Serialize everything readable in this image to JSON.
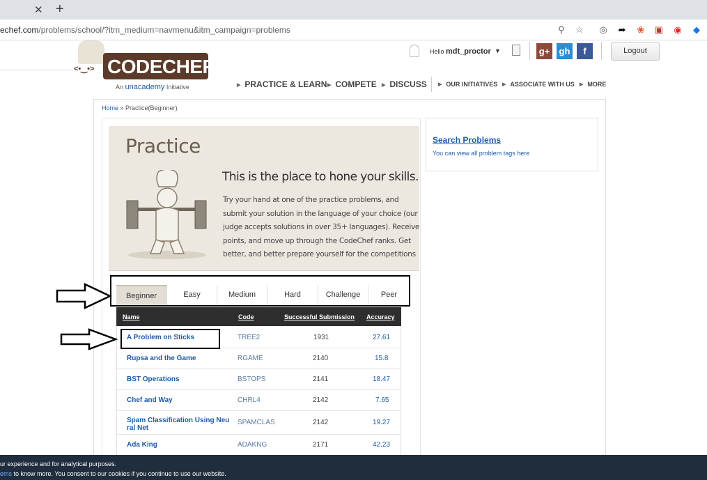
{
  "browser": {
    "url_host": "echef.com",
    "url_path": "/problems/school/?itm_medium=navmenu&itm_campaign=problems",
    "new_tab": "+",
    "close_tab": "✕"
  },
  "header": {
    "logo_text": "CODECHEF",
    "logo_face": "<•‿•>",
    "tagline_prefix": "An",
    "tagline_brand": "unacademy",
    "tagline_suffix": "Initiative",
    "greeting": "Hello",
    "username": "mdt_proctor",
    "logout": "Logout",
    "social": [
      "g+",
      "gh",
      "f"
    ],
    "nav_main": [
      "PRACTICE & LEARN",
      "COMPETE",
      "DISCUSS"
    ],
    "nav_small": [
      "OUR INITIATIVES",
      "ASSOCIATE WITH US",
      "MORE"
    ]
  },
  "breadcrumb": {
    "home": "Home",
    "sep": " » ",
    "current": "Practice(Beginner)"
  },
  "banner": {
    "title": "Practice",
    "headline": "This is the place to hone your skills.",
    "body": "Try your hand at one of the practice problems, and submit your solution in the language of your choice (our judge accepts solutions in over 35+ languages). Receive points, and move up through the CodeChef ranks. Get better, and better prepare yourself for the competitions"
  },
  "tabs": [
    "Beginner",
    "Easy",
    "Medium",
    "Hard",
    "Challenge",
    "Peer"
  ],
  "active_tab": "Beginner",
  "table": {
    "headers": [
      "Name",
      "Code",
      "Successful Submission",
      "Accuracy"
    ],
    "rows": [
      {
        "name": "A Problem on Sticks",
        "code": "TREE2",
        "submissions": "1931",
        "accuracy": "27.61"
      },
      {
        "name": "Rupsa and the Game",
        "code": "RGAME",
        "submissions": "2140",
        "accuracy": "15.8"
      },
      {
        "name": "BST Operations",
        "code": "BSTOPS",
        "submissions": "2141",
        "accuracy": "18.47"
      },
      {
        "name": "Chef and Way",
        "code": "CHRL4",
        "submissions": "2142",
        "accuracy": "7.65"
      },
      {
        "name": "Spam Classification Using Neu ral Net",
        "code": "SPAMCLAS",
        "submissions": "2142",
        "accuracy": "19.27"
      },
      {
        "name": "Ada King",
        "code": "ADAKNG",
        "submissions": "2171",
        "accuracy": "42.23"
      }
    ]
  },
  "sidebar": {
    "title": "Search Problems",
    "subtitle": "You can view all problem tags here"
  },
  "cookie": {
    "line1": "ur experience and for analytical purposes.",
    "line2_link": "ems",
    "line2_text": " to know more. You consent to our cookies if you continue to use our website."
  },
  "colors": {
    "link": "#1d5ba8",
    "logo_brown": "#5b3a29",
    "table_head": "#2e2e2e",
    "cookie_bg": "#1f2d3d"
  }
}
